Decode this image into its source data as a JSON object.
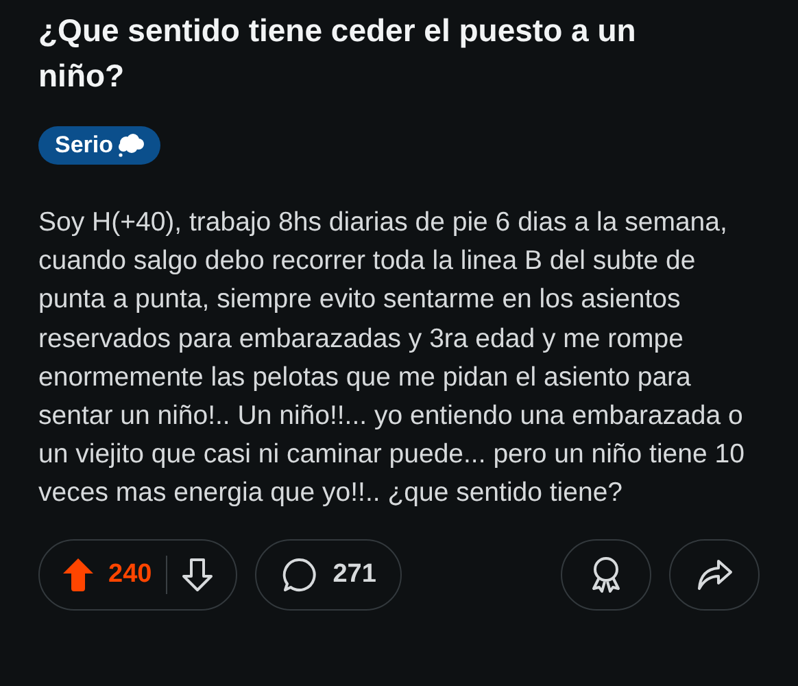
{
  "post": {
    "title": "¿Que sentido tiene ceder el puesto a un niño?",
    "flair": {
      "label": "Serio",
      "color": "#0b4f8c"
    },
    "body": "Soy H(+40), trabajo 8hs diarias de pie 6 dias a la semana, cuando salgo debo recorrer toda la linea B del subte de punta a punta, siempre evito sentarme en los asientos reservados para embarazadas y 3ra edad y me rompe enormemente las pelotas que me pidan el asiento para sentar un niño!.. Un niño!!... yo entiendo una embarazada o un viejito que casi ni caminar puede... pero un niño tiene 10 veces mas energia que yo!!.. ¿que sentido tiene?",
    "upvoted": true,
    "score": "240",
    "comments": "271"
  }
}
